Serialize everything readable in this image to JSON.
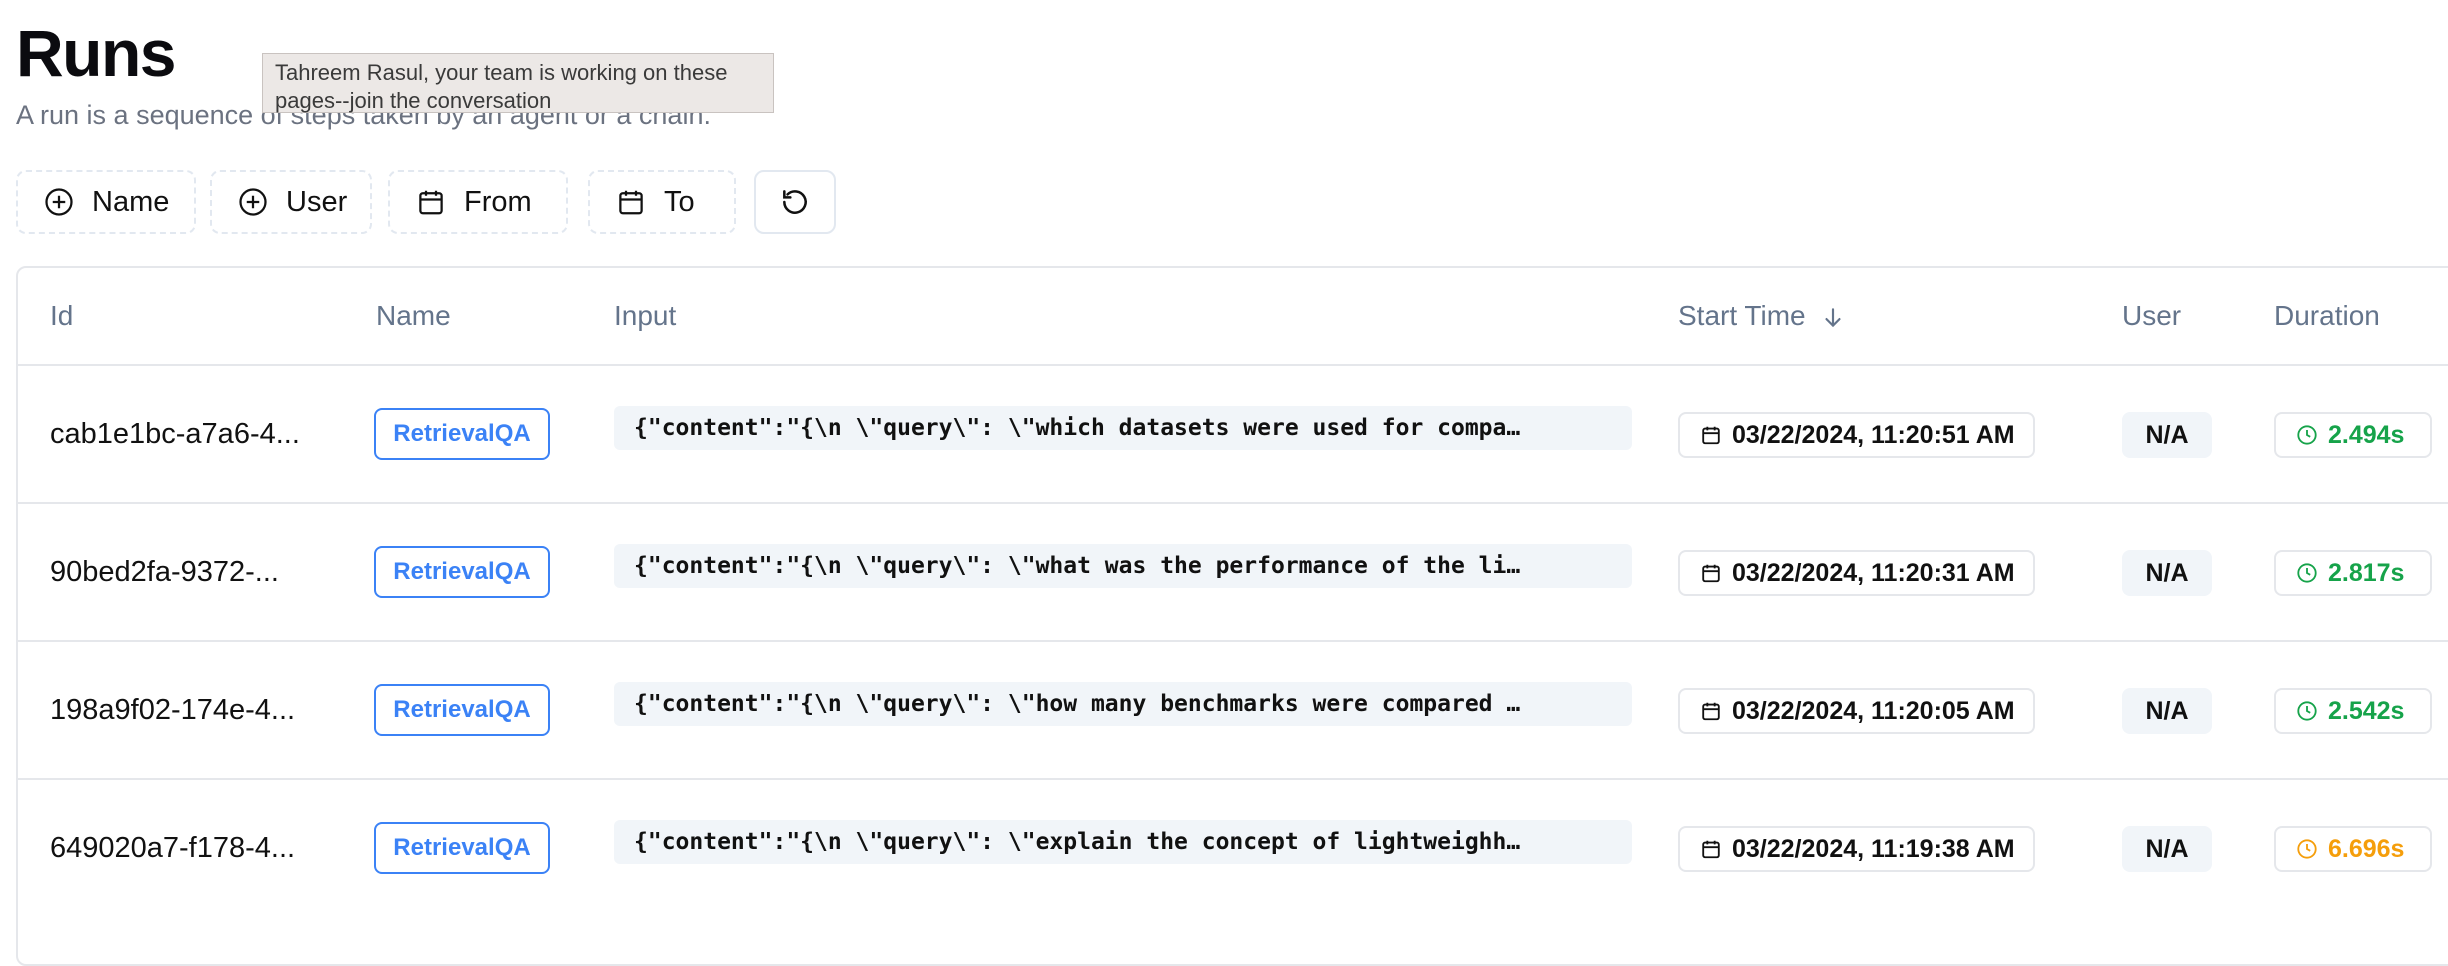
{
  "page": {
    "title": "Runs",
    "subtitle": "A run is a sequence of steps taken by an agent or a chain."
  },
  "tooltip": {
    "text": "Tahreem Rasul, your team is working on these pages--join the conversation"
  },
  "filters": [
    {
      "label": "Name",
      "icon": "plus-circle-icon"
    },
    {
      "label": "User",
      "icon": "plus-circle-icon"
    },
    {
      "label": "From",
      "icon": "calendar-icon"
    },
    {
      "label": "To",
      "icon": "calendar-icon"
    }
  ],
  "reset_icon": "reset-icon",
  "table": {
    "columns": [
      "Id",
      "Name",
      "Input",
      "Start Time",
      "User",
      "Duration"
    ],
    "sort_column": "Start Time",
    "sort_direction": "descending",
    "rows": [
      {
        "id": "cab1e1bc-a7a6-4...",
        "name": "RetrievalQA",
        "input": "{\"content\":\"{\\n \\\"query\\\": \\\"which datasets were used for compa…",
        "start_time": "03/22/2024, 11:20:51 AM",
        "user": "N/A",
        "duration": "2.494s",
        "duration_status": "fast"
      },
      {
        "id": "90bed2fa-9372-...",
        "name": "RetrievalQA",
        "input": "{\"content\":\"{\\n \\\"query\\\": \\\"what was the performance of the li…",
        "start_time": "03/22/2024, 11:20:31 AM",
        "user": "N/A",
        "duration": "2.817s",
        "duration_status": "fast"
      },
      {
        "id": "198a9f02-174e-4...",
        "name": "RetrievalQA",
        "input": "{\"content\":\"{\\n \\\"query\\\": \\\"how many benchmarks were compared …",
        "start_time": "03/22/2024, 11:20:05 AM",
        "user": "N/A",
        "duration": "2.542s",
        "duration_status": "fast"
      },
      {
        "id": "649020a7-f178-4...",
        "name": "RetrievalQA",
        "input": "{\"content\":\"{\\n \\\"query\\\": \\\"explain the concept of lightweighh…",
        "start_time": "03/22/2024, 11:19:38 AM",
        "user": "N/A",
        "duration": "6.696s",
        "duration_status": "slow"
      }
    ]
  },
  "colors": {
    "accent": "#3b82f6",
    "duration_fast": "#16a34a",
    "duration_slow": "#f59e0b",
    "muted_text": "#64748b"
  }
}
